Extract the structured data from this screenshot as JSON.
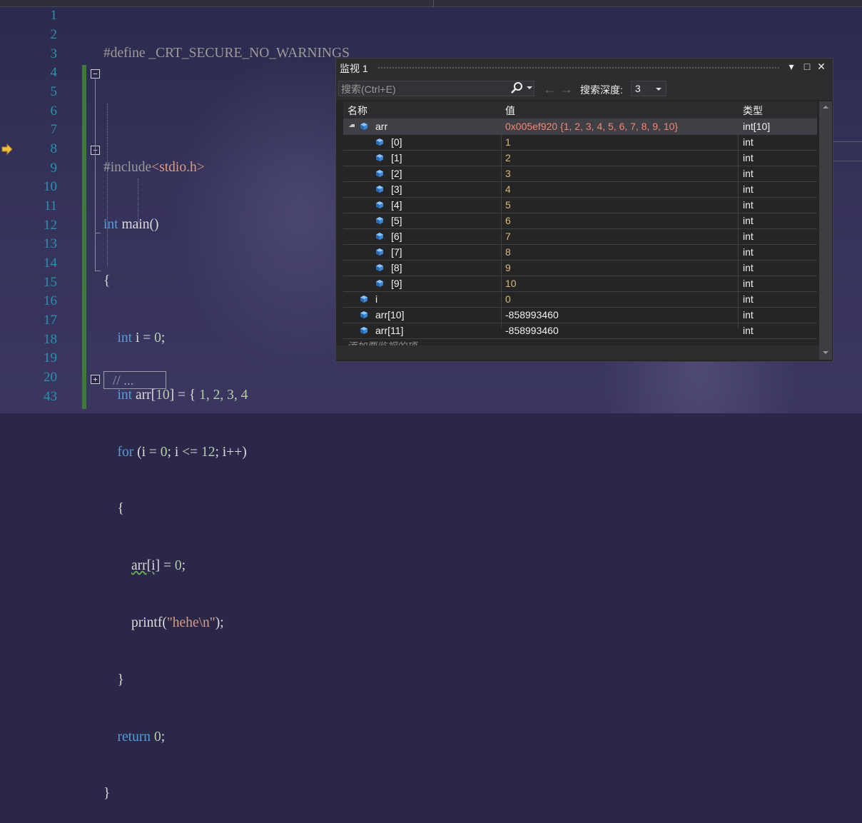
{
  "topbar": {
    "left_text": "",
    "right_text": ""
  },
  "editor": {
    "line_numbers": [
      "1",
      "2",
      "3",
      "4",
      "5",
      "6",
      "7",
      "8",
      "9",
      "10",
      "11",
      "12",
      "13",
      "14",
      "15",
      "16",
      "17",
      "18",
      "19",
      "20",
      "43"
    ],
    "code": {
      "l1_pp": "#define _CRT_SECURE_NO_WARNINGS",
      "l3_pp": "#include",
      "l3_hdr": "<stdio.h>",
      "l4_kw": "int",
      "l4_rest": " main()",
      "l5": "{",
      "l6_kw": "int",
      "l6_rest": " i = ",
      "l6_num": "0",
      "l6_end": ";",
      "l7_kw": "int",
      "l7_rest": " arr[",
      "l7_num": "10",
      "l7_end": "] = { ",
      "l7_vals": "1, 2, 3, 4",
      "l8_kw": "for",
      "l8_rest": " (i = ",
      "l8_num": "0",
      "l8_mid": "; i <= ",
      "l8_num2": "12",
      "l8_end": "; i++)",
      "l9": "{",
      "l10_a": "arr",
      "l10_b": "[i]",
      "l10_rest": " = ",
      "l10_num": "0",
      "l10_end": ";",
      "l11_fn": "printf(",
      "l11_str": "\"hehe\\n\"",
      "l11_end": ");",
      "l12": "}",
      "l13_kw": "return",
      "l13_num": " 0",
      "l13_end": ";",
      "l14": "}",
      "collapsed": "// ..."
    }
  },
  "watch": {
    "title": "监视 1",
    "search_placeholder": "搜索(Ctrl+E)",
    "depth_label": "搜索深度:",
    "depth_value": "3",
    "columns": {
      "name": "名称",
      "value": "值",
      "type": "类型"
    },
    "rows": [
      {
        "name": "arr",
        "value": "0x005ef920 {1, 2, 3, 4, 5, 6, 7, 8, 9, 10}",
        "type": "int[10]"
      },
      {
        "name": "[0]",
        "value": "1",
        "type": "int"
      },
      {
        "name": "[1]",
        "value": "2",
        "type": "int"
      },
      {
        "name": "[2]",
        "value": "3",
        "type": "int"
      },
      {
        "name": "[3]",
        "value": "4",
        "type": "int"
      },
      {
        "name": "[4]",
        "value": "5",
        "type": "int"
      },
      {
        "name": "[5]",
        "value": "6",
        "type": "int"
      },
      {
        "name": "[6]",
        "value": "7",
        "type": "int"
      },
      {
        "name": "[7]",
        "value": "8",
        "type": "int"
      },
      {
        "name": "[8]",
        "value": "9",
        "type": "int"
      },
      {
        "name": "[9]",
        "value": "10",
        "type": "int"
      },
      {
        "name": "i",
        "value": "0",
        "type": "int"
      },
      {
        "name": "arr[10]",
        "value": "-858993460",
        "type": "int"
      },
      {
        "name": "arr[11]",
        "value": "-858993460",
        "type": "int"
      }
    ],
    "add_item": "添加要监视的项"
  },
  "colors": {
    "keyword": "#569cd6",
    "line_number": "#2b91af",
    "value_changed": "#f48771",
    "value_normal": "#d7ba7d"
  }
}
